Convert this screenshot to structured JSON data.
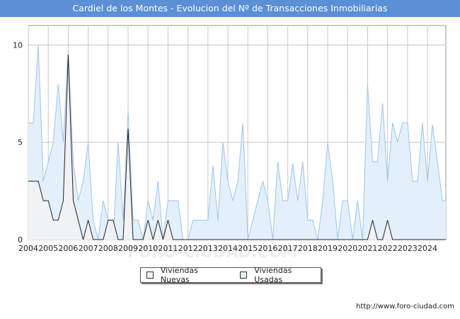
{
  "title": "Cardiel de los Montes - Evolucion del Nº de Transacciones Inmobiliarias",
  "footer_url": "http://www.foro-ciudad.com",
  "watermark": "FORO-CIUDAD.COM",
  "chart_data": {
    "type": "area",
    "title": "Cardiel de los Montes - Evolucion del Nº de Transacciones Inmobiliarias",
    "xlabel": "",
    "ylabel": "",
    "x_range": [
      2004,
      2024.92
    ],
    "ylim": [
      0,
      11
    ],
    "y_ticks": [
      0,
      5,
      10
    ],
    "x_tick_labels": [
      "2004",
      "2005",
      "2006",
      "2007",
      "2008",
      "2009",
      "2010",
      "2011",
      "2012",
      "2013",
      "2014",
      "2015",
      "2016",
      "2017",
      "2018",
      "2019",
      "2020",
      "2021",
      "2022",
      "2023",
      "2024"
    ],
    "grid": true,
    "legend_position": "bottom",
    "colors": {
      "nuevas_fill": "#f2f2f2",
      "usadas_fill": "#e3f0fc",
      "nuevas_line": "#222222",
      "usadas_line": "#9ec4ea"
    },
    "series": [
      {
        "name": "Viviendas Nuevas",
        "x": [
          2004.0,
          2004.25,
          2004.5,
          2004.75,
          2005.0,
          2005.25,
          2005.5,
          2005.75,
          2006.0,
          2006.25,
          2006.5,
          2006.75,
          2007.0,
          2007.25,
          2007.5,
          2007.75,
          2008.0,
          2008.25,
          2008.5,
          2008.75,
          2009.0,
          2009.25,
          2009.5,
          2009.75,
          2010.0,
          2010.25,
          2010.5,
          2010.75,
          2011.0,
          2011.25,
          2011.5,
          2020.75,
          2021.0,
          2021.25,
          2021.5,
          2021.75,
          2022.0,
          2022.25,
          2022.5,
          2024.92
        ],
        "y": [
          3,
          3,
          3,
          2,
          2,
          1,
          1,
          2,
          9.5,
          2,
          1,
          0,
          1,
          0,
          0,
          0,
          1,
          1,
          0,
          0,
          5.7,
          0,
          0,
          0,
          1,
          0,
          1,
          0,
          1,
          0,
          0,
          0,
          0,
          1,
          0,
          0,
          1,
          0,
          0,
          0
        ]
      },
      {
        "name": "Viviendas Usadas",
        "x": [
          2004.0,
          2004.25,
          2004.5,
          2004.75,
          2005.0,
          2005.25,
          2005.5,
          2005.75,
          2006.0,
          2006.25,
          2006.5,
          2006.75,
          2007.0,
          2007.25,
          2007.5,
          2007.75,
          2008.0,
          2008.25,
          2008.5,
          2008.75,
          2009.0,
          2009.25,
          2009.5,
          2009.75,
          2010.0,
          2010.25,
          2010.5,
          2010.75,
          2011.0,
          2011.25,
          2011.5,
          2011.75,
          2012.0,
          2012.25,
          2012.5,
          2012.75,
          2013.0,
          2013.25,
          2013.5,
          2013.75,
          2014.0,
          2014.25,
          2014.5,
          2014.75,
          2015.0,
          2015.25,
          2015.5,
          2015.75,
          2016.0,
          2016.25,
          2016.5,
          2016.75,
          2017.0,
          2017.25,
          2017.5,
          2017.75,
          2018.0,
          2018.25,
          2018.5,
          2018.75,
          2019.0,
          2019.25,
          2019.5,
          2019.75,
          2020.0,
          2020.25,
          2020.5,
          2020.75,
          2021.0,
          2021.25,
          2021.5,
          2021.75,
          2022.0,
          2022.25,
          2022.5,
          2022.75,
          2023.0,
          2023.25,
          2023.5,
          2023.75,
          2024.0,
          2024.25,
          2024.5,
          2024.75,
          2024.92
        ],
        "y": [
          6,
          6,
          10,
          3,
          4,
          5,
          8,
          5,
          9.7,
          4,
          2,
          3,
          5,
          1,
          0,
          2,
          1,
          0,
          5,
          1,
          6.6,
          1,
          1,
          0,
          2,
          1,
          3,
          0,
          2,
          2,
          2,
          0,
          0,
          1,
          1,
          1,
          1,
          3.8,
          1,
          5,
          3,
          2,
          3,
          6,
          0,
          1,
          2,
          3,
          2,
          0,
          4,
          2,
          2,
          3.9,
          2,
          4,
          1,
          1,
          0,
          2,
          5,
          3,
          0,
          2,
          2,
          0,
          2,
          0,
          8,
          4,
          4,
          7,
          3,
          6,
          5,
          6,
          6,
          3,
          3,
          6,
          3,
          5.9,
          4,
          2,
          2
        ]
      }
    ]
  }
}
